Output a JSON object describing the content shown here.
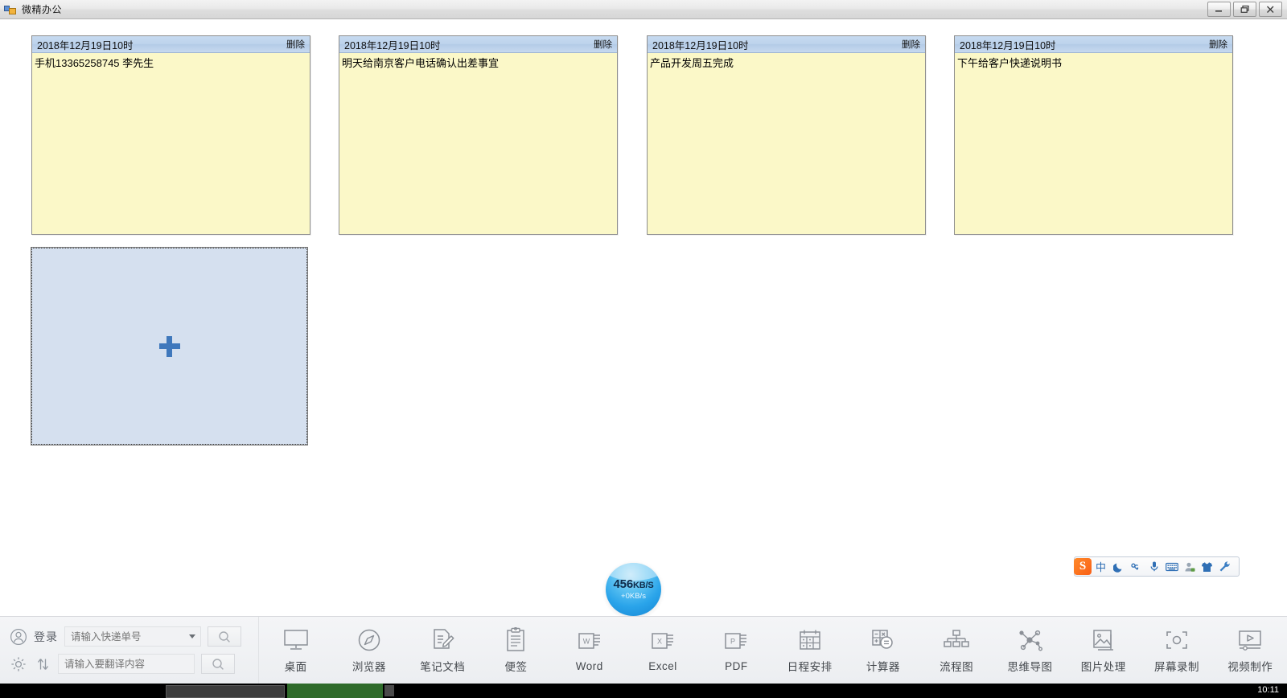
{
  "window": {
    "title": "微精办公",
    "icon_name": "app-icon",
    "buttons": {
      "minimize": "minimize-button",
      "restore": "restore-button",
      "close": "close-button"
    }
  },
  "notes": [
    {
      "date": "2018年12月19日10时",
      "delete_label": "删除",
      "text": "手机13365258745 李先生"
    },
    {
      "date": "2018年12月19日10时",
      "delete_label": "删除",
      "text": "明天给南京客户电话确认出差事宜"
    },
    {
      "date": "2018年12月19日10时",
      "delete_label": "删除",
      "text": "产品开发周五完成"
    },
    {
      "date": "2018年12月19日10时",
      "delete_label": "删除",
      "text": "下午给客户快递说明书"
    }
  ],
  "add_note": {
    "icon_name": "plus-icon",
    "label": ""
  },
  "netspeed": {
    "value": "456",
    "unit": "KB/S",
    "secondary": "+0KB/s"
  },
  "ime": {
    "logo": "S",
    "items": [
      {
        "name": "chinese-mode-icon",
        "glyph": "中"
      },
      {
        "name": "moon-icon",
        "glyph": "☾"
      },
      {
        "name": "punctuation-icon",
        "glyph": "°,"
      },
      {
        "name": "microphone-icon",
        "glyph": "🎤"
      },
      {
        "name": "keyboard-icon",
        "glyph": "⌨"
      },
      {
        "name": "user-icon",
        "glyph": "👤"
      },
      {
        "name": "skin-icon",
        "glyph": "👕"
      },
      {
        "name": "toolbox-icon",
        "glyph": "🔧"
      }
    ]
  },
  "toolbar": {
    "login_label": "登录",
    "login_icon": "user-circle-icon",
    "settings_icon": "gear-icon",
    "translate_icon": "translate-icon",
    "express_field": {
      "placeholder": "请输入快递单号",
      "value": "",
      "search_icon": "search-icon",
      "dropdown_icon": "chevron-down-icon"
    },
    "translate_field": {
      "placeholder": "请输入要翻译内容",
      "value": "",
      "search_icon": "search-icon"
    },
    "items": [
      {
        "label": "桌面",
        "icon": "monitor-icon"
      },
      {
        "label": "浏览器",
        "icon": "compass-icon"
      },
      {
        "label": "笔记文档",
        "icon": "note-pencil-icon"
      },
      {
        "label": "便签",
        "icon": "clipboard-icon"
      },
      {
        "label": "Word",
        "icon": "word-icon"
      },
      {
        "label": "Excel",
        "icon": "excel-icon"
      },
      {
        "label": "PDF",
        "icon": "pdf-icon"
      },
      {
        "label": "日程安排",
        "icon": "calendar-icon"
      },
      {
        "label": "计算器",
        "icon": "calculator-icon"
      },
      {
        "label": "流程图",
        "icon": "flowchart-icon"
      },
      {
        "label": "思维导图",
        "icon": "mindmap-icon"
      },
      {
        "label": "图片处理",
        "icon": "image-icon"
      },
      {
        "label": "屏幕录制",
        "icon": "screen-record-icon"
      },
      {
        "label": "视频制作",
        "icon": "video-icon"
      }
    ]
  },
  "taskbar": {
    "clock": "10:11"
  },
  "colors": {
    "note_body": "#FBF8C8",
    "note_header": "#BDD3EC",
    "add_box": "#D5E0EF",
    "plus": "#3F78BC",
    "accent": "#2AA4EA"
  }
}
